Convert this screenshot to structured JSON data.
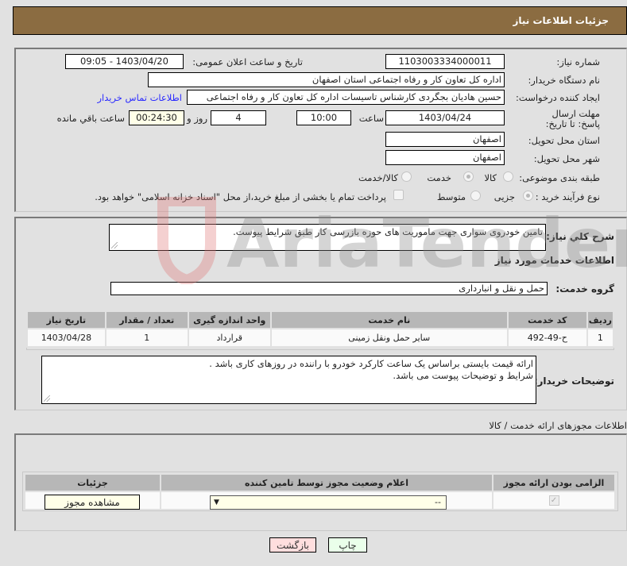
{
  "header": {
    "title": "جزئیات اطلاعات نیاز"
  },
  "details": {
    "need_number_label": "شماره نیاز:",
    "need_number": "1103003334000011",
    "announce_label": "تاریخ و ساعت اعلان عمومی:",
    "announce_value": "1403/04/20 - 09:05",
    "buyer_org_label": "نام دستگاه خریدار:",
    "buyer_org": "اداره کل تعاون  کار و رفاه اجتماعی استان اصفهان",
    "creator_label": "ایجاد کننده درخواست:",
    "creator": "حسین هادیان بجگردی کارشناس تاسیسات اداره کل تعاون  کار و رفاه اجتماعی",
    "buyer_contact_link": "اطلاعات تماس خریدار",
    "deadline_label": "مهلت ارسال پاسخ: تا تاریخ:",
    "deadline_date": "1403/04/24",
    "time_label": "ساعت",
    "deadline_time": "10:00",
    "days_value": "4",
    "days_label": "روز و",
    "remaining_time": "00:24:30",
    "remaining_label": "ساعت باقي مانده",
    "province_label": "استان محل تحویل:",
    "province": "اصفهان",
    "city_label": "شهر محل تحویل:",
    "city": "اصفهان",
    "category_label": "طبقه بندی موضوعی:",
    "category_options": [
      {
        "label": "کالا",
        "checked": false
      },
      {
        "label": "خدمت",
        "checked": true
      },
      {
        "label": "کالا/خدمت",
        "checked": false
      }
    ],
    "process_label": "نوع فرآیند خرید :",
    "process_options": [
      {
        "label": "جزیی",
        "checked": true
      },
      {
        "label": "متوسط",
        "checked": false
      }
    ],
    "treasury_note": "پرداخت تمام یا بخشی از مبلغ خرید،از محل \"اسناد خزانه اسلامی\" خواهد بود."
  },
  "description": {
    "label": "شرح کلي نیاز:",
    "value": "تامین خودروی سواری جهت ماموریت های حوزه بازرسی کار طبق شرایط پیوست."
  },
  "services": {
    "section_title": "اطلاعات خدمات مورد نیاز",
    "group_label": "گروه خدمت:",
    "group_value": "حمل و نقل و انبارداری",
    "columns": [
      "ردیف",
      "کد خدمت",
      "نام خدمت",
      "واحد اندازه گیری",
      "تعداد / مقدار",
      "تاریخ نیاز"
    ],
    "rows": [
      [
        "1",
        "ح-49-492",
        "سایر حمل ونقل زمینی",
        "قرارداد",
        "1",
        "1403/04/28"
      ]
    ]
  },
  "buyer_notes": {
    "label": "توضیحات خریدار:",
    "line1": "ارائه قیمت بایستی براساس یک ساعت کارکرد خودرو با راننده در روزهای کاری باشد .",
    "line2": "شرایط و توضیحات پیوست می باشد."
  },
  "permits": {
    "section_title": "اطلاعات مجوزهای ارائه خدمت / کالا",
    "columns": [
      "الزامی بودن ارائه مجوز",
      "اعلام وضعیت مجوز توسط تامین کننده",
      "جزئیات"
    ],
    "status_select": "--",
    "view_button": "مشاهده مجوز"
  },
  "footer": {
    "print_button": "چاپ",
    "back_button": "بازگشت"
  },
  "watermark": {
    "text": "AriaTender.neT"
  }
}
